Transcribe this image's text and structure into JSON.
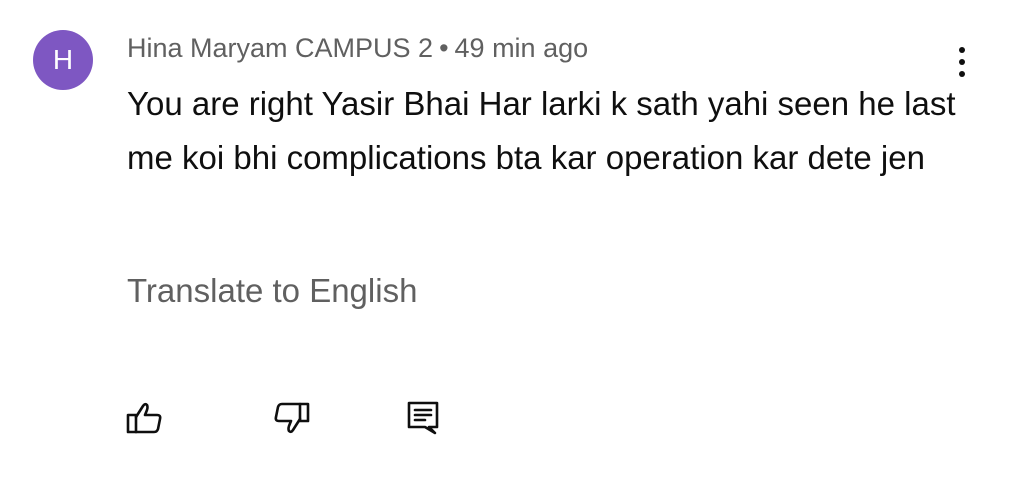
{
  "comment": {
    "avatar_letter": "H",
    "avatar_color": "#7e57c2",
    "author": "Hina Maryam CAMPUS 2",
    "separator": "•",
    "timestamp": "49 min ago",
    "text": "You are right Yasir Bhai Har larki k sath yahi seen he last me koi bhi complications bta kar operation kar dete jen",
    "translate_label": "Translate to English"
  },
  "icons": {
    "more": "more-vert-icon",
    "like": "thumbs-up-icon",
    "dislike": "thumbs-down-icon",
    "reply": "reply-comment-icon"
  }
}
